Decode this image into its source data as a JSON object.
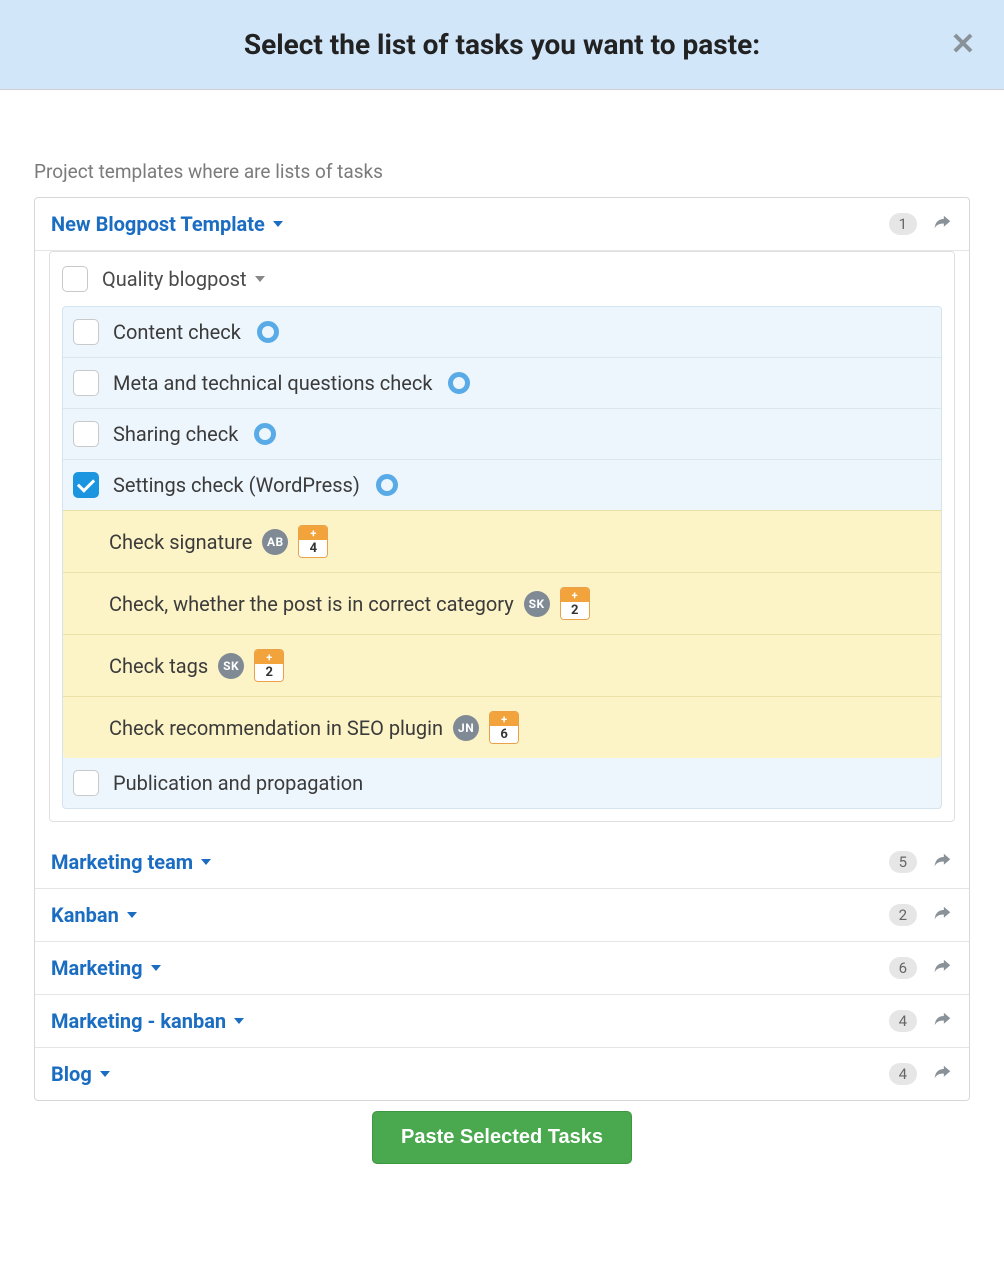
{
  "header": {
    "title": "Select the list of tasks you want to paste:"
  },
  "section_label": "Project templates where are lists of tasks",
  "templates": [
    {
      "name": "New Blogpost Template",
      "count": "1",
      "expanded": true,
      "group": {
        "name": "Quality blogpost",
        "tasks": [
          {
            "label": "Content check",
            "checked": false,
            "ring": true
          },
          {
            "label": "Meta and technical questions check",
            "checked": false,
            "ring": true
          },
          {
            "label": "Sharing check",
            "checked": false,
            "ring": true
          },
          {
            "label": "Settings check (WordPress)",
            "checked": true,
            "ring": true,
            "subtasks": [
              {
                "label": "Check signature",
                "avatar": "AB",
                "due": "4"
              },
              {
                "label": "Check, whether the post is in correct category",
                "avatar": "SK",
                "due": "2"
              },
              {
                "label": "Check tags",
                "avatar": "SK",
                "due": "2"
              },
              {
                "label": "Check recommendation in SEO plugin",
                "avatar": "JN",
                "due": "6"
              }
            ]
          },
          {
            "label": "Publication and propagation",
            "checked": false,
            "ring": false
          }
        ]
      }
    },
    {
      "name": "Marketing team",
      "count": "5"
    },
    {
      "name": "Kanban",
      "count": "2"
    },
    {
      "name": "Marketing",
      "count": "6"
    },
    {
      "name": "Marketing - kanban",
      "count": "4"
    },
    {
      "name": "Blog",
      "count": "4"
    }
  ],
  "footer": {
    "paste_button": "Paste Selected Tasks"
  },
  "due_plus": "+"
}
